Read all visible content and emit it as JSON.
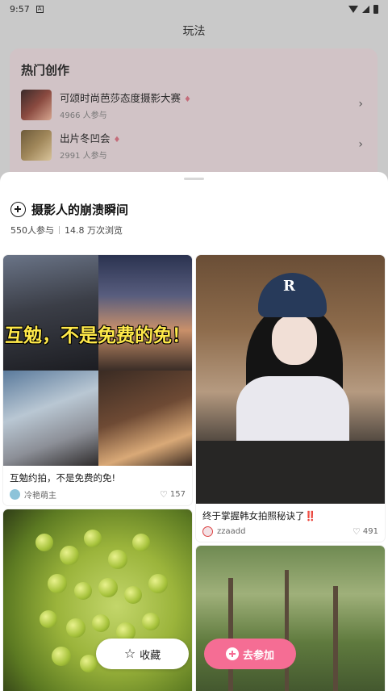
{
  "status_bar": {
    "time": "9:57",
    "notification_glyph": "A"
  },
  "background": {
    "title": "玩法",
    "hot": {
      "heading": "热门创作",
      "items": [
        {
          "name": "可颂时尚芭莎态度摄影大赛",
          "count": "4966 人参与"
        },
        {
          "name": "出片冬凹会",
          "count": "2991 人参与"
        }
      ]
    }
  },
  "sheet": {
    "title": "摄影人的崩溃瞬间",
    "participants": "550人参与",
    "views": "14.8 万次浏览",
    "posts": [
      {
        "overlay_text": "互勉，不是免费的免！",
        "caption": "互勉约拍，不是免费的免!",
        "author": "冷艳萌主",
        "likes": "157"
      },
      {
        "overlay_text": "R",
        "caption": "终于掌握韩女拍照秘诀了‼️",
        "author": "zzaadd",
        "likes": "491"
      },
      {
        "caption": "",
        "author": "",
        "likes": ""
      },
      {
        "caption": "",
        "author": "",
        "likes": ""
      }
    ],
    "fav_label": "收藏",
    "join_label": "去参加"
  },
  "colors": {
    "accent": "#f56d94"
  }
}
